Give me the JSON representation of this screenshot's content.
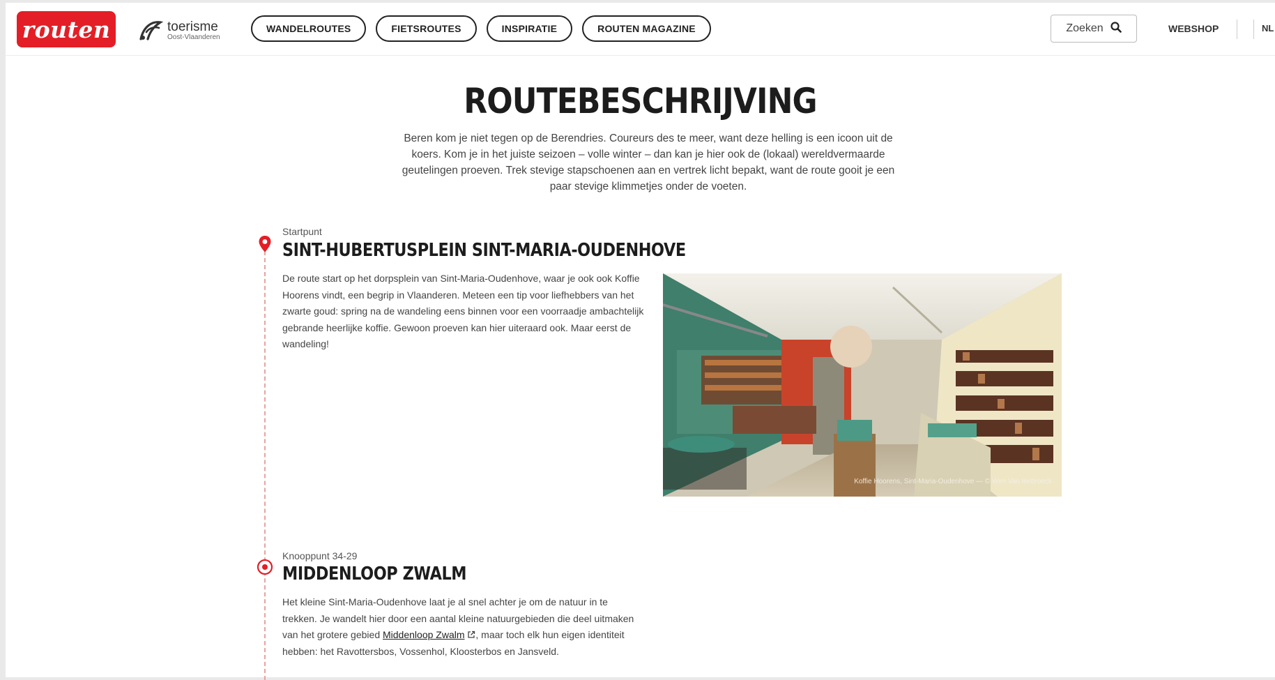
{
  "header": {
    "logo_text": "routen",
    "partner_name": "toerisme",
    "partner_sub": "Oost-Vlaanderen",
    "nav": [
      {
        "label": "WANDELROUTES"
      },
      {
        "label": "FIETSROUTES"
      },
      {
        "label": "INSPIRATIE"
      },
      {
        "label": "ROUTEN MAGAZINE"
      }
    ],
    "search_label": "Zoeken",
    "webshop_label": "WEBSHOP",
    "language": "NL"
  },
  "main": {
    "title": "ROUTEBESCHRIJVING",
    "intro": "Beren kom je niet tegen op de Berendries. Coureurs des te meer, want deze helling is een icoon uit de koers. Kom je in het juiste seizoen – volle winter – dan kan je hier ook de (lokaal) wereldvermaarde geutelingen proeven. Trek stevige stapschoenen aan en vertrek licht bepakt, want de route gooit je een paar stevige klimmetjes onder de voeten."
  },
  "stops": [
    {
      "label": "Startpunt",
      "title": "SINT-HUBERTUSPLEIN SINT-MARIA-OUDENHOVE",
      "text": "De route start op het dorpsplein van Sint-Maria-Oudenhove, waar je ook ook Koffie Hoorens vindt, een begrip in Vlaanderen. Meteen een tip voor liefhebbers van het zwarte goud: spring na de wandeling eens binnen voor een voorraadje ambachtelijk gebrande heerlijke koffie. Gewoon proeven kan hier uiteraard ook. Maar eerst de wandeling!",
      "photo_caption": "Koffie Hoorens, Sint-Maria-Oudenhove — © Wim Van Isebroeck"
    },
    {
      "label": "Knooppunt 34-29",
      "title": "MIDDENLOOP ZWALM",
      "text_before": "Het kleine Sint-Maria-Oudenhove laat je al snel achter je om de natuur in te trekken. Je wandelt hier door een aantal kleine natuurgebieden die deel uitmaken van het grotere gebied ",
      "link": "Middenloop Zwalm",
      "text_after": ", maar toch elk hun eigen identiteit hebben: het Ravottersbos, Vossenhol, Kloosterbos en Jansveld."
    }
  ],
  "colors": {
    "brand_red": "#e41e26",
    "timeline": "#e7a3a3"
  },
  "icons": {
    "start": "map-pin-icon",
    "node": "target-icon",
    "search": "search-icon",
    "external": "external-link-icon"
  }
}
